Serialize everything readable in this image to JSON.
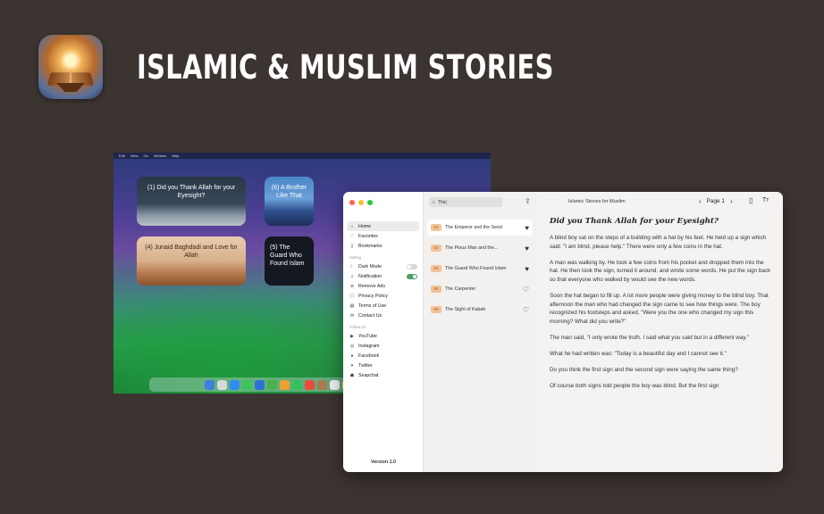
{
  "hero": {
    "title": "ISLAMIC & MUSLIM STORIES"
  },
  "desktop": {
    "menubar": [
      "Edit",
      "View",
      "Go",
      "Window",
      "Help"
    ],
    "widgets": [
      "(1) Did you Thank Allah for your Eyesight?",
      "(6) A Brother Like That",
      "(4) Junaid Baghdadi and Love for Allah",
      "(5) The Guard Who Found Islam"
    ]
  },
  "window": {
    "title": "Islamic Stories for Muslim",
    "page_label": "Page 1",
    "search_value": "The|",
    "sidebar": {
      "nav": [
        {
          "label": "Home",
          "icon": "home-icon"
        },
        {
          "label": "Favorites",
          "icon": "heart-icon"
        },
        {
          "label": "Bookmarks",
          "icon": "bookmark-icon"
        }
      ],
      "setting_label": "Setting",
      "settings": [
        {
          "label": "Dark Mode",
          "icon": "moon-icon",
          "toggle": false
        },
        {
          "label": "Notification",
          "icon": "bell-icon",
          "toggle": true
        },
        {
          "label": "Remove Ads",
          "icon": "no-ads-icon"
        },
        {
          "label": "Privacy Policy",
          "icon": "info-icon"
        },
        {
          "label": "Terms of Use",
          "icon": "document-icon"
        },
        {
          "label": "Contact Us",
          "icon": "mail-icon"
        }
      ],
      "follow_label": "Follow Us",
      "social": [
        {
          "label": "YouTube",
          "icon": "youtube-icon"
        },
        {
          "label": "Instagram",
          "icon": "instagram-icon"
        },
        {
          "label": "Facebook",
          "icon": "facebook-icon"
        },
        {
          "label": "Twitter",
          "icon": "twitter-icon"
        },
        {
          "label": "Snapchat",
          "icon": "snapchat-icon"
        }
      ],
      "version": "Version 1.0"
    },
    "stories": [
      {
        "num": "01",
        "title": "The Emperor and the Seed",
        "favorite": true
      },
      {
        "num": "02",
        "title": "The Pious Man and the...",
        "favorite": true
      },
      {
        "num": "04",
        "title": "The Guard Who Found Islam",
        "favorite": true
      },
      {
        "num": "06",
        "title": "The Carpenter",
        "favorite": false
      },
      {
        "num": "09",
        "title": "The Sight of Kabah",
        "favorite": false
      }
    ],
    "article": {
      "heading": "Did you Thank Allah for your Eyesight?",
      "paragraphs": [
        "A blind boy sat on the steps of a building with a hat by his feet. He held up a sign which said: \"I am blind, please help.\" There were only a few coins in the hat.",
        "A man was walking by. He took a few coins from his pocket and dropped them into the hat. He then took the sign, turned it around, and wrote some words. He put the sign back so that everyone who walked by would see the new words.",
        "Soon the hat began to fill up. A lot more people were giving money to the blind boy. That afternoon the man who had changed the sign came to see how things were. The boy recognized his footsteps and asked, \"Were you the one who changed my sign this morning? What did you write?\"",
        "The man said, \"I only wrote the truth. I said what you said but in a different way.\"",
        "What he had written was: \"Today is a beautiful day and I cannot see it.\"",
        "Do you think the first sign and the second sign were saying the same thing?",
        "Of course both signs told people the boy was blind. But the first sign"
      ]
    }
  },
  "colors": {
    "background": "#3c3431",
    "badge_bg": "#f3c39a",
    "badge_text": "#a35a21",
    "toggle_on": "#4fa06a"
  }
}
